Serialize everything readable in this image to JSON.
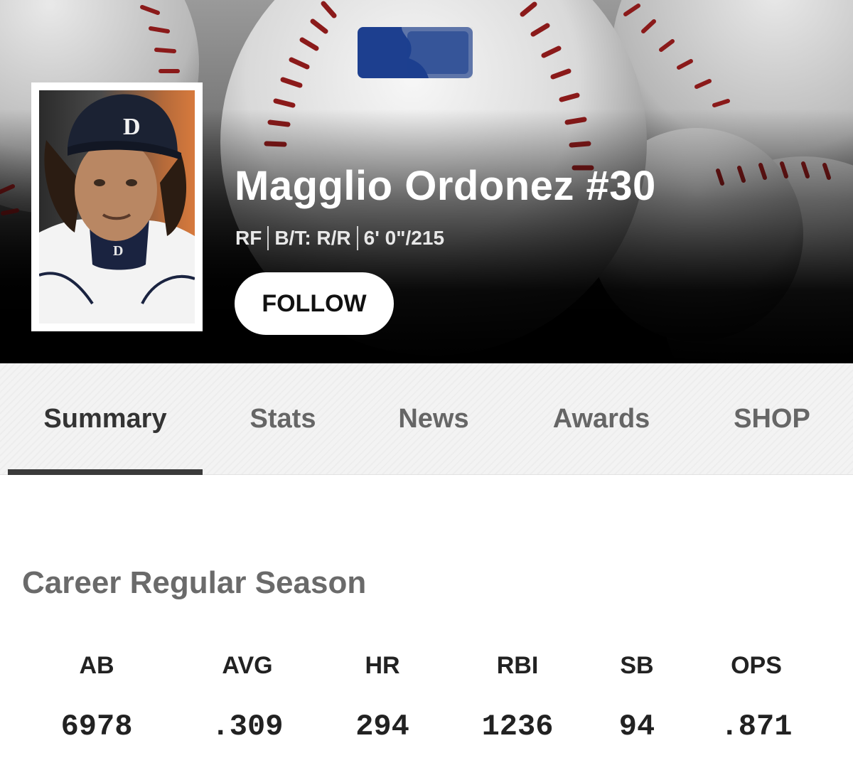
{
  "player": {
    "name": "Magglio Ordonez #30",
    "position": "RF",
    "bats_throws": "B/T: R/R",
    "height_weight": "6' 0\"/215",
    "follow_label": "FOLLOW"
  },
  "tabs": [
    {
      "label": "Summary",
      "active": true
    },
    {
      "label": "Stats",
      "active": false
    },
    {
      "label": "News",
      "active": false
    },
    {
      "label": "Awards",
      "active": false
    },
    {
      "label": "SHOP",
      "active": false
    }
  ],
  "career": {
    "title": "Career Regular Season",
    "stats": [
      {
        "label": "AB",
        "value": "6978"
      },
      {
        "label": "AVG",
        "value": ".309"
      },
      {
        "label": "HR",
        "value": "294"
      },
      {
        "label": "RBI",
        "value": "1236"
      },
      {
        "label": "SB",
        "value": "94"
      },
      {
        "label": "OPS",
        "value": ".871"
      }
    ]
  },
  "colors": {
    "stitch_red": "#8b1a1a",
    "logo_blue": "#1d3f8f",
    "tab_active_underline": "#3a3a3a"
  }
}
